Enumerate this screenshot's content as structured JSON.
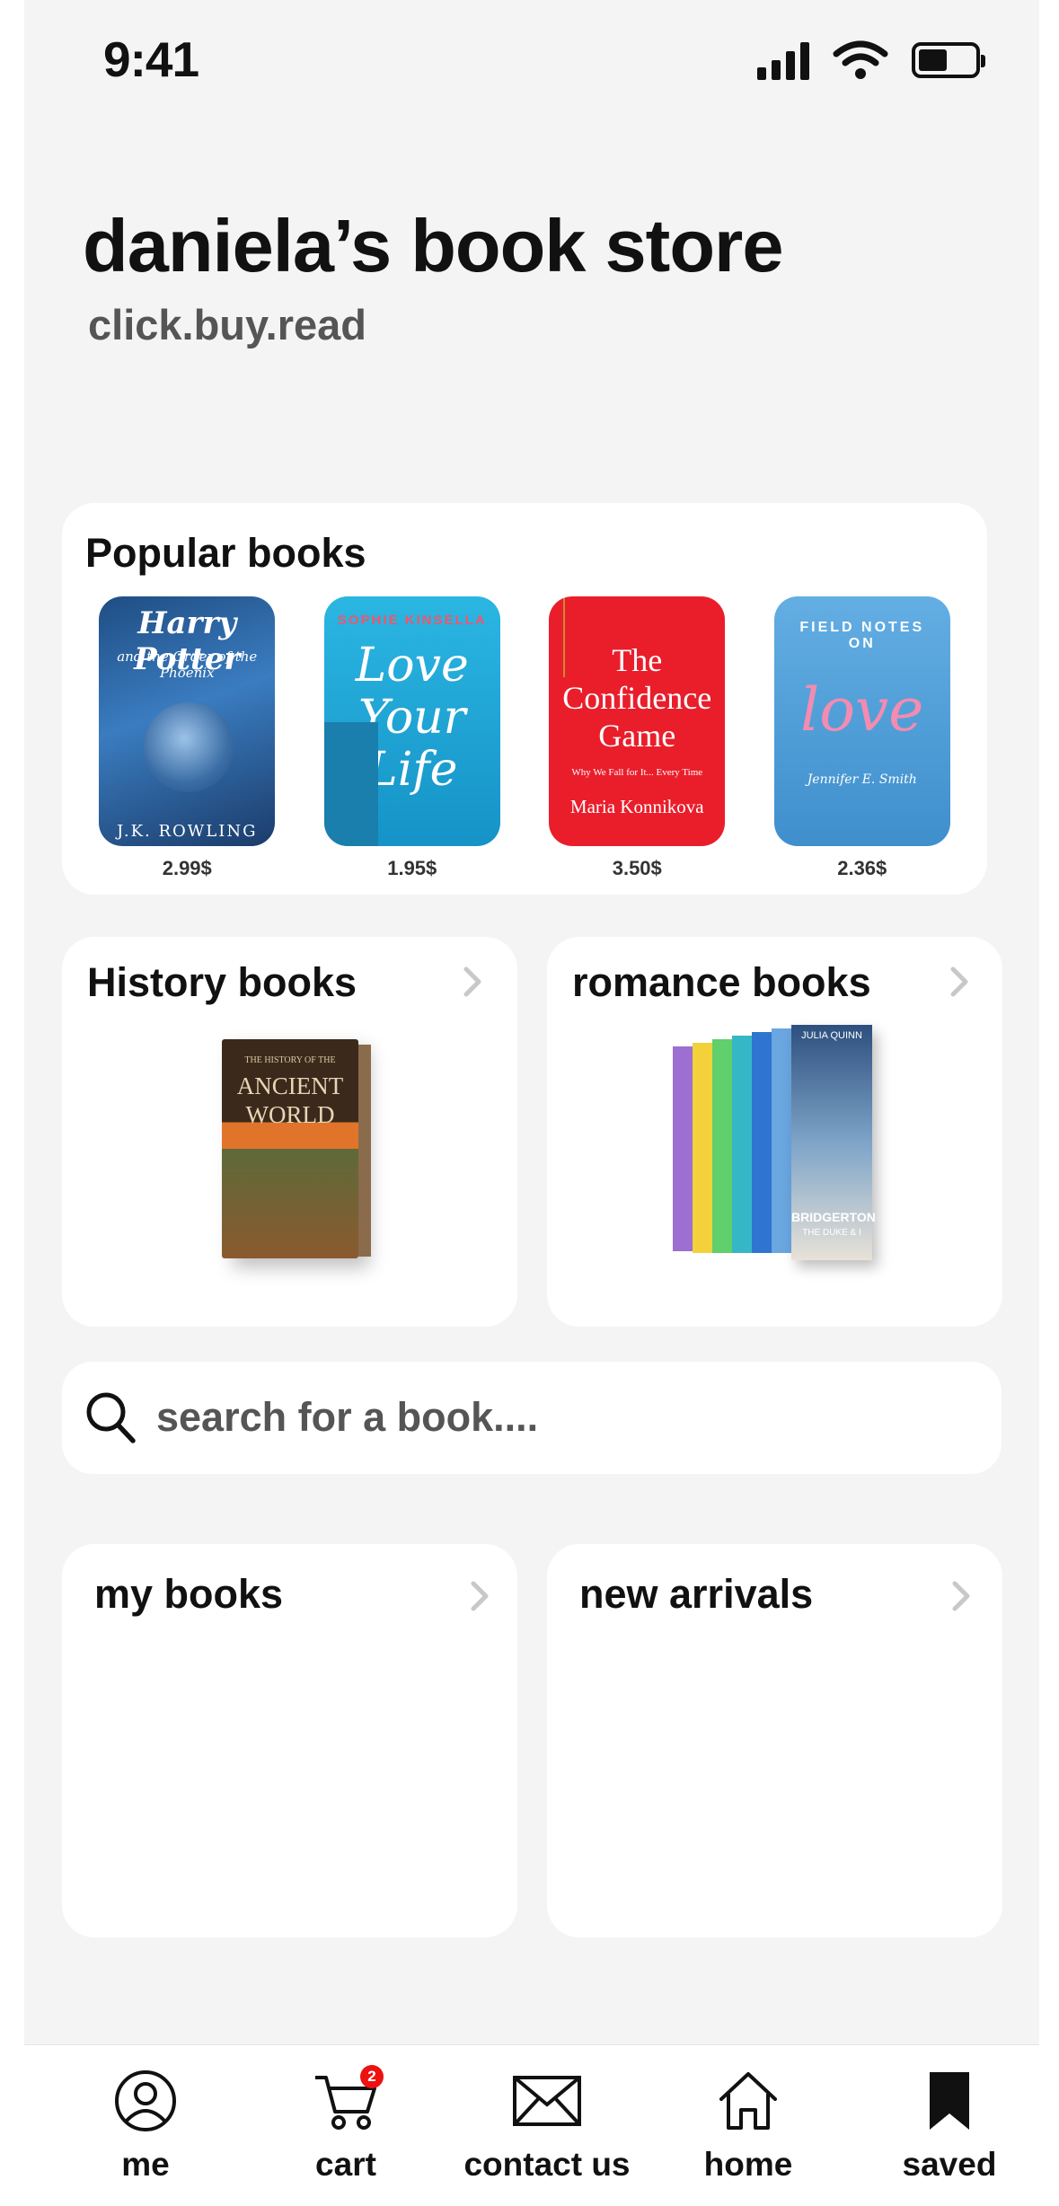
{
  "status_bar": {
    "time": "9:41",
    "signal_icon": "cellular-signal-icon",
    "wifi_icon": "wifi-icon",
    "battery_icon": "battery-icon",
    "battery_level": 0.46
  },
  "header": {
    "title": "daniela’s book store",
    "subtitle": "click.buy.read"
  },
  "popular": {
    "title": "Popular books",
    "books": [
      {
        "cover_title": "Harry Potter",
        "cover_subtitle": "and the Order of the Phoenix",
        "cover_author": "J.K. ROWLING",
        "price": "2.99$",
        "color": "#2a5b8e"
      },
      {
        "cover_title": "Love Your Life",
        "cover_author": "SOPHIE KINSELLA",
        "price": "1.95$",
        "color": "#22a9d6"
      },
      {
        "cover_title": "The Confidence Game",
        "cover_subtitle": "Why We Fall for It... Every Time",
        "cover_author": "Maria Konnikova",
        "price": "3.50$",
        "color": "#ea1e2b"
      },
      {
        "cover_title": "love",
        "cover_subtitle": "FIELD NOTES ON",
        "cover_author": "Jennifer E. Smith",
        "price": "2.36$",
        "color": "#4b9ad6"
      }
    ]
  },
  "categories": {
    "history": {
      "title": "History books",
      "cover_title": "ANCIENT WORLD",
      "cover_subtitle": "THE HISTORY OF THE"
    },
    "romance": {
      "title": "romance books",
      "cover_title": "BRIDGERTON",
      "cover_subtitle": "THE DUKE & I",
      "cover_author": "JULIA QUINN"
    }
  },
  "search": {
    "placeholder": "search for a book....",
    "icon": "search-icon"
  },
  "sections": {
    "my_books": "my books",
    "new_arrivals": "new arrivals"
  },
  "tabbar": {
    "items": [
      {
        "label": "me",
        "icon": "user-icon"
      },
      {
        "label": "cart",
        "icon": "cart-icon",
        "badge": "2"
      },
      {
        "label": "contact us",
        "icon": "mail-icon"
      },
      {
        "label": "home",
        "icon": "home-icon"
      },
      {
        "label": "saved",
        "icon": "bookmark-icon"
      }
    ]
  },
  "colors": {
    "background": "#f4f4f4",
    "card": "#ffffff",
    "badge": "#ee1111"
  }
}
